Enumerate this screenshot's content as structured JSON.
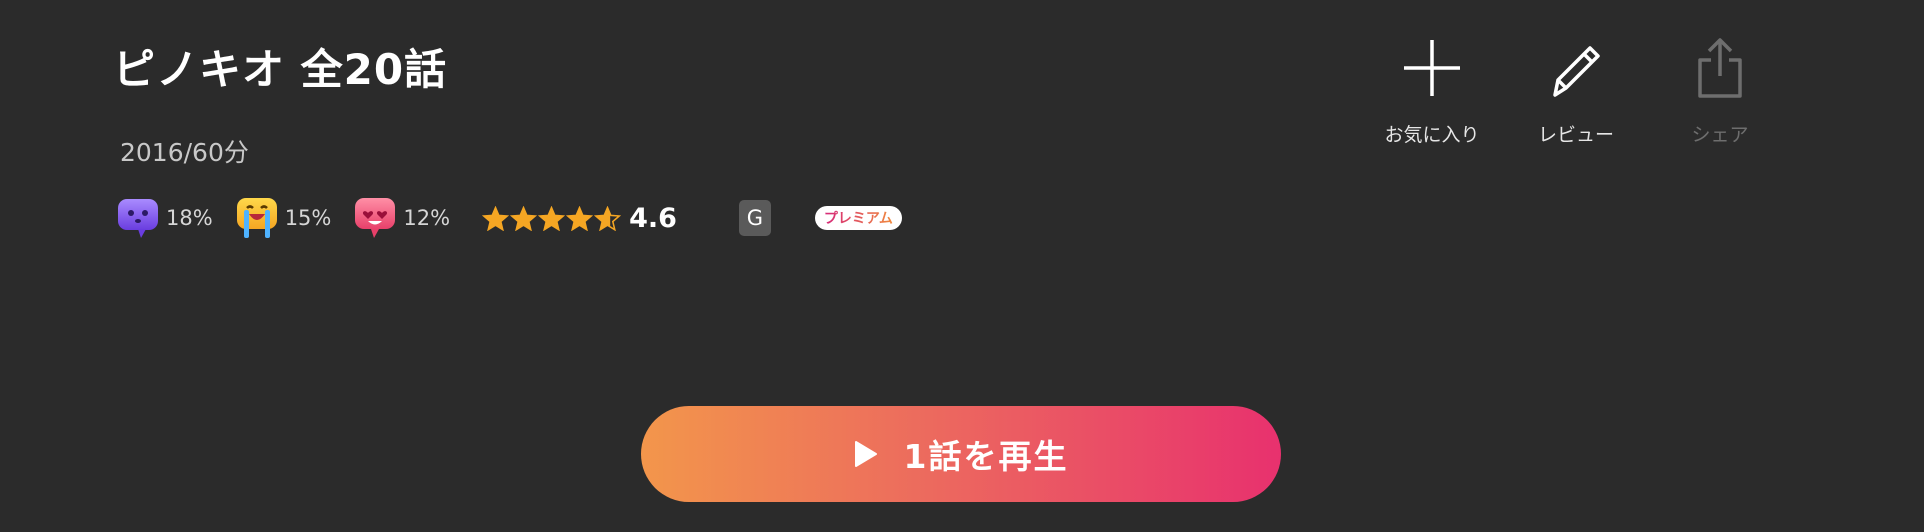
{
  "title": "ピノキオ 全20話",
  "meta": "2016/60分",
  "reactions": [
    {
      "icon": "purple-face-icon",
      "percent": "18%"
    },
    {
      "icon": "crying-face-icon",
      "percent": "15%"
    },
    {
      "icon": "heart-eyes-face-icon",
      "percent": "12%"
    }
  ],
  "rating": {
    "score": "4.6",
    "value": 4.6,
    "max": 5,
    "star_color": "#f5a623"
  },
  "age_rating": "G",
  "premium_badge": "プレミアム",
  "actions": {
    "favorite": {
      "label": "お気に入り",
      "icon": "plus-icon"
    },
    "review": {
      "label": "レビュー",
      "icon": "pencil-icon"
    },
    "share": {
      "label": "シェア",
      "icon": "share-icon",
      "disabled": true
    }
  },
  "play_button": {
    "label": "1話を再生",
    "icon": "play-icon",
    "gradient": [
      "#f3964b",
      "#e8316e"
    ]
  }
}
